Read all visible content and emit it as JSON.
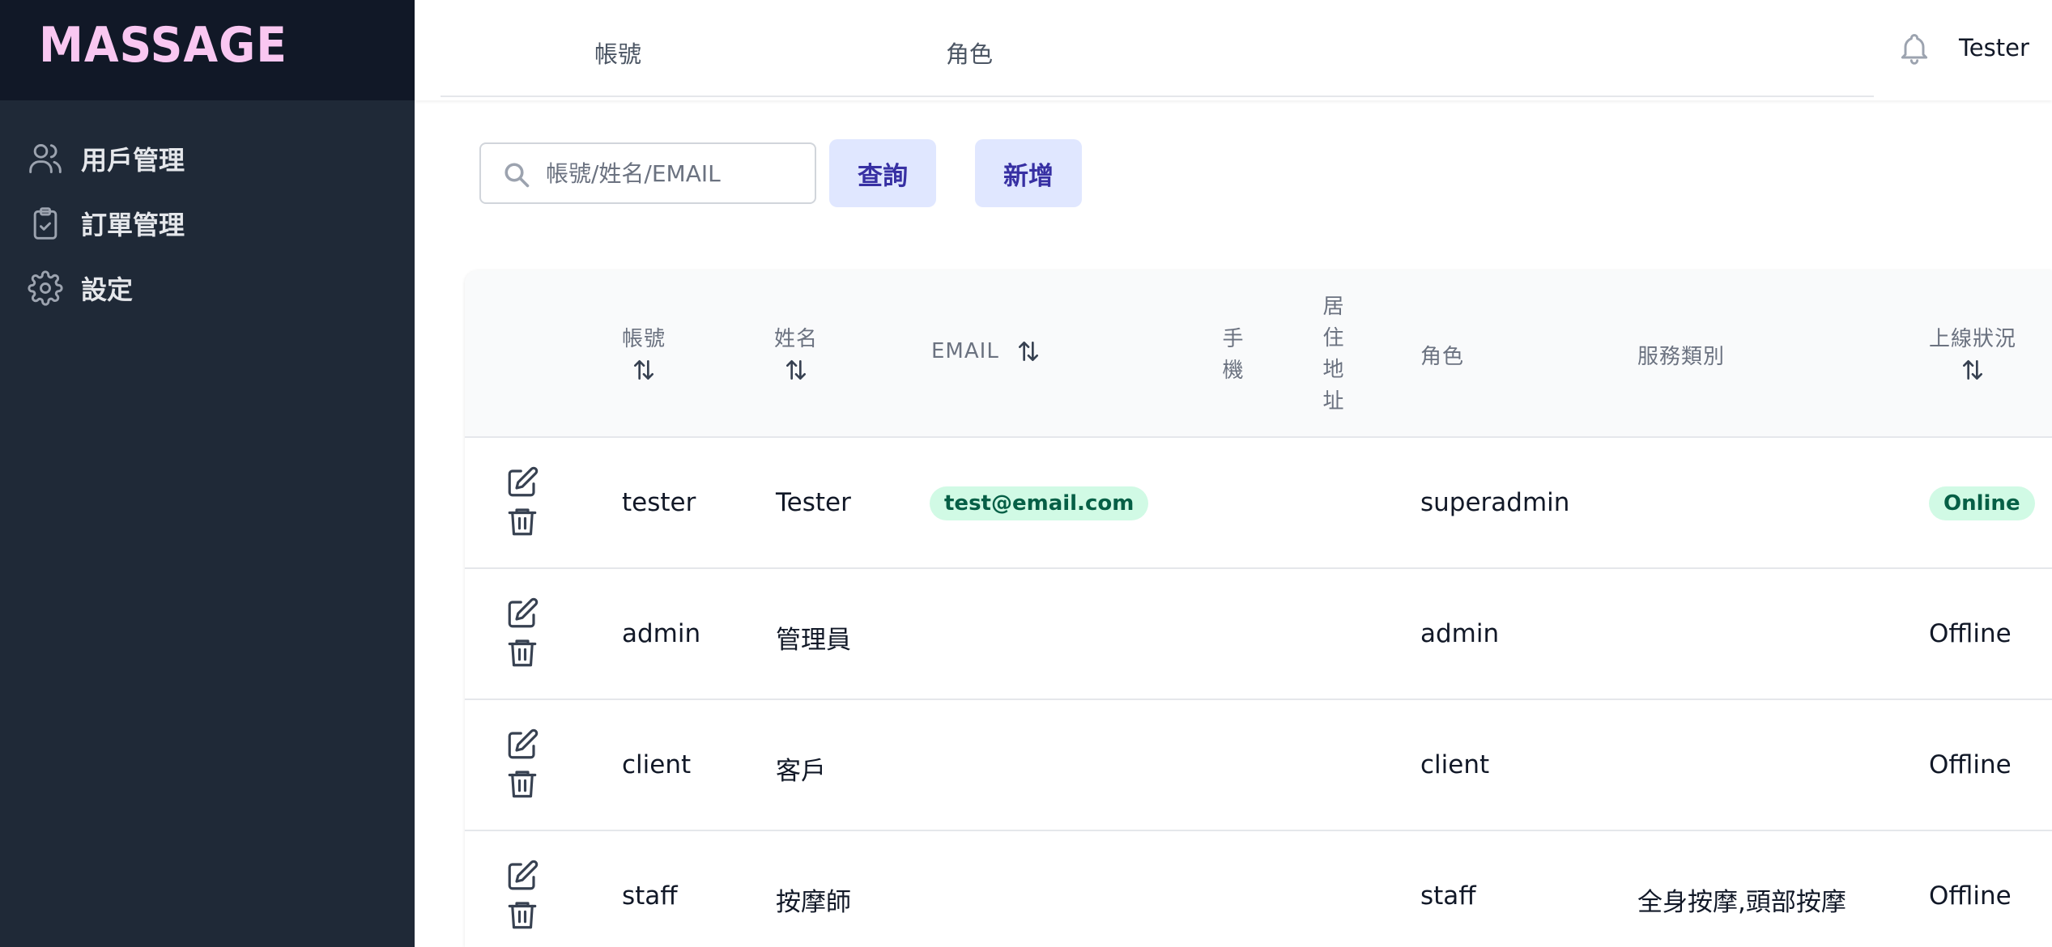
{
  "brand": {
    "name": "MASSAGE"
  },
  "sidebar": {
    "items": [
      {
        "label": "用戶管理",
        "icon": "users-icon"
      },
      {
        "label": "訂單管理",
        "icon": "clipboard-check-icon"
      },
      {
        "label": "設定",
        "icon": "gear-icon"
      }
    ]
  },
  "header": {
    "tabs": [
      "帳號",
      "角色"
    ],
    "user_name": "Tester"
  },
  "search": {
    "placeholder": "帳號/姓名/EMAIL",
    "query_label": "查詢",
    "add_label": "新增"
  },
  "table": {
    "columns": {
      "account": "帳號",
      "name": "姓名",
      "email": "EMAIL",
      "phone": "手機",
      "address": "居住地址",
      "role": "角色",
      "service": "服務類別",
      "status": "上線狀況"
    },
    "rows": [
      {
        "account": "tester",
        "name": "Tester",
        "email": "test@email.com",
        "role": "superadmin",
        "service": "",
        "status": "Online"
      },
      {
        "account": "admin",
        "name": "管理員",
        "email": "",
        "role": "admin",
        "service": "",
        "status": "Offline"
      },
      {
        "account": "client",
        "name": "客戶",
        "email": "",
        "role": "client",
        "service": "",
        "status": "Offline"
      },
      {
        "account": "staff",
        "name": "按摩師",
        "email": "",
        "role": "staff",
        "service": "全身按摩,頭部按摩",
        "status": "Offline"
      }
    ]
  },
  "colors": {
    "sidebar_bg": "#1f2937",
    "brand_bg": "#111827",
    "brand_text": "#f9c7f1",
    "button_bg": "#e0e7ff",
    "button_text": "#3730a3",
    "badge_bg": "#d1fae5",
    "badge_text": "#065f46"
  }
}
